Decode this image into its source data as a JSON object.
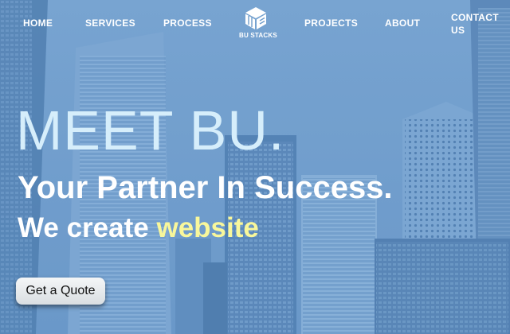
{
  "nav": {
    "home": "HOME",
    "services": "SERVICES",
    "process": "PROCESS",
    "projects": "PROJECTS",
    "about": "ABOUT",
    "contact": "CONTACT US"
  },
  "logo": {
    "text": "BU STACKS",
    "icon": "stacked-cube-icon"
  },
  "hero": {
    "headline": "MEET BU.",
    "tagline": "Your Partner In Success.",
    "subline_prefix": "We create",
    "subline_highlight": "website",
    "cta_label": "Get a Quote"
  },
  "colors": {
    "headline": "#d6eefb",
    "highlight": "#f8f79b",
    "nav_text": "#ffffff",
    "background_tint": "#6e9ccb"
  }
}
